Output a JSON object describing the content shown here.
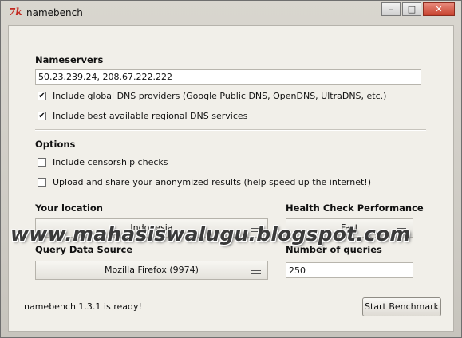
{
  "window": {
    "title": "namebench",
    "icon": "tk-feather-icon",
    "controls": {
      "minimize": "–",
      "maximize": "□",
      "close": "✕"
    }
  },
  "nameservers": {
    "heading": "Nameservers",
    "value": "50.23.239.24, 208.67.222.222",
    "include_global_label": "Include global DNS providers (Google Public DNS, OpenDNS, UltraDNS, etc.)",
    "include_global_checked": true,
    "include_regional_label": "Include best available regional DNS services",
    "include_regional_checked": true
  },
  "options": {
    "heading": "Options",
    "censorship_label": "Include censorship checks",
    "censorship_checked": false,
    "upload_label": "Upload and share your anonymized results (help speed up the internet!)",
    "upload_checked": false
  },
  "location": {
    "heading": "Your location",
    "value": "Indonesia"
  },
  "health": {
    "heading": "Health Check Performance",
    "value": "Fast"
  },
  "query_source": {
    "heading": "Query Data Source",
    "value": "Mozilla Firefox (9974)"
  },
  "queries": {
    "heading": "Number of queries",
    "value": "250"
  },
  "status": {
    "text": "namebench 1.3.1 is ready!"
  },
  "actions": {
    "start_label": "Start Benchmark"
  },
  "watermark": {
    "text": "www.mahasiswalugu.blogspot.com"
  }
}
